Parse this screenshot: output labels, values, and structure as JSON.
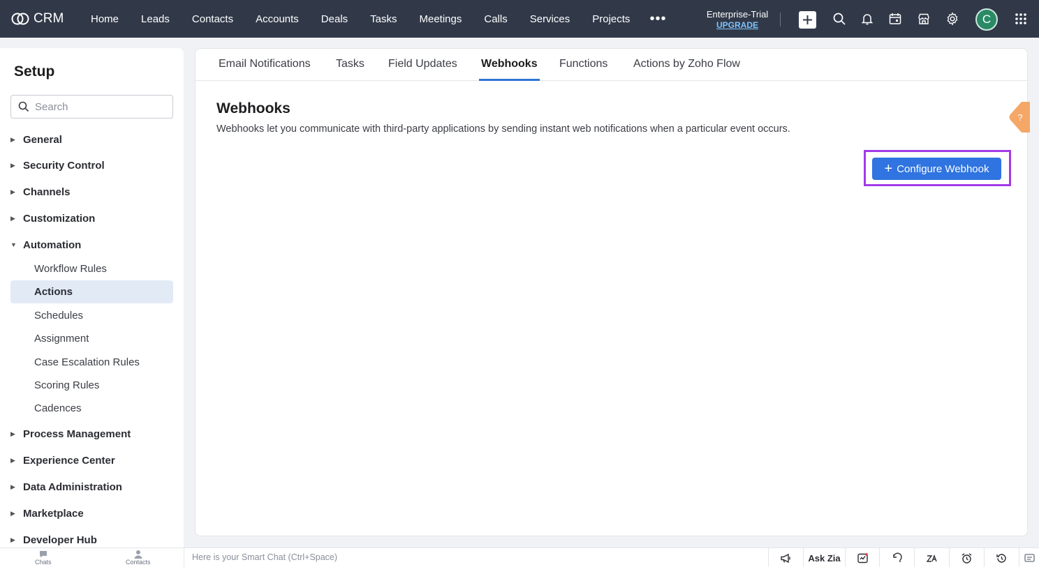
{
  "brand": {
    "name": "CRM"
  },
  "nav": {
    "items": [
      "Home",
      "Leads",
      "Contacts",
      "Accounts",
      "Deals",
      "Tasks",
      "Meetings",
      "Calls",
      "Services",
      "Projects"
    ],
    "more": "•••"
  },
  "trial": {
    "edition": "Enterprise-Trial",
    "upgrade": "UPGRADE"
  },
  "user": {
    "initial": "C"
  },
  "sidebar": {
    "title": "Setup",
    "search_placeholder": "Search",
    "categories": {
      "general": "General",
      "security": "Security Control",
      "channels": "Channels",
      "customization": "Customization",
      "automation": "Automation",
      "process": "Process Management",
      "experience": "Experience Center",
      "data": "Data Administration",
      "marketplace": "Marketplace",
      "developer": "Developer Hub"
    },
    "automation_items": [
      "Workflow Rules",
      "Actions",
      "Schedules",
      "Assignment",
      "Case Escalation Rules",
      "Scoring Rules",
      "Cadences"
    ]
  },
  "tabs": [
    "Email Notifications",
    "Tasks",
    "Field Updates",
    "Webhooks",
    "Functions",
    "Actions by Zoho Flow"
  ],
  "main": {
    "title": "Webhooks",
    "description": "Webhooks let you communicate with third-party applications by sending instant web notifications when a particular event occurs.",
    "configure_button": "Configure Webhook",
    "help_glyph": "?"
  },
  "bottombar": {
    "chats": "Chats",
    "contacts": "Contacts",
    "smartchat_placeholder": "Here is your Smart Chat (Ctrl+Space)",
    "ask_zia": "Ask Zia"
  },
  "colors": {
    "topbar": "#313949",
    "accent": "#2f74e0",
    "highlight": "#a23be8",
    "active_item": "#e2eaf6"
  }
}
